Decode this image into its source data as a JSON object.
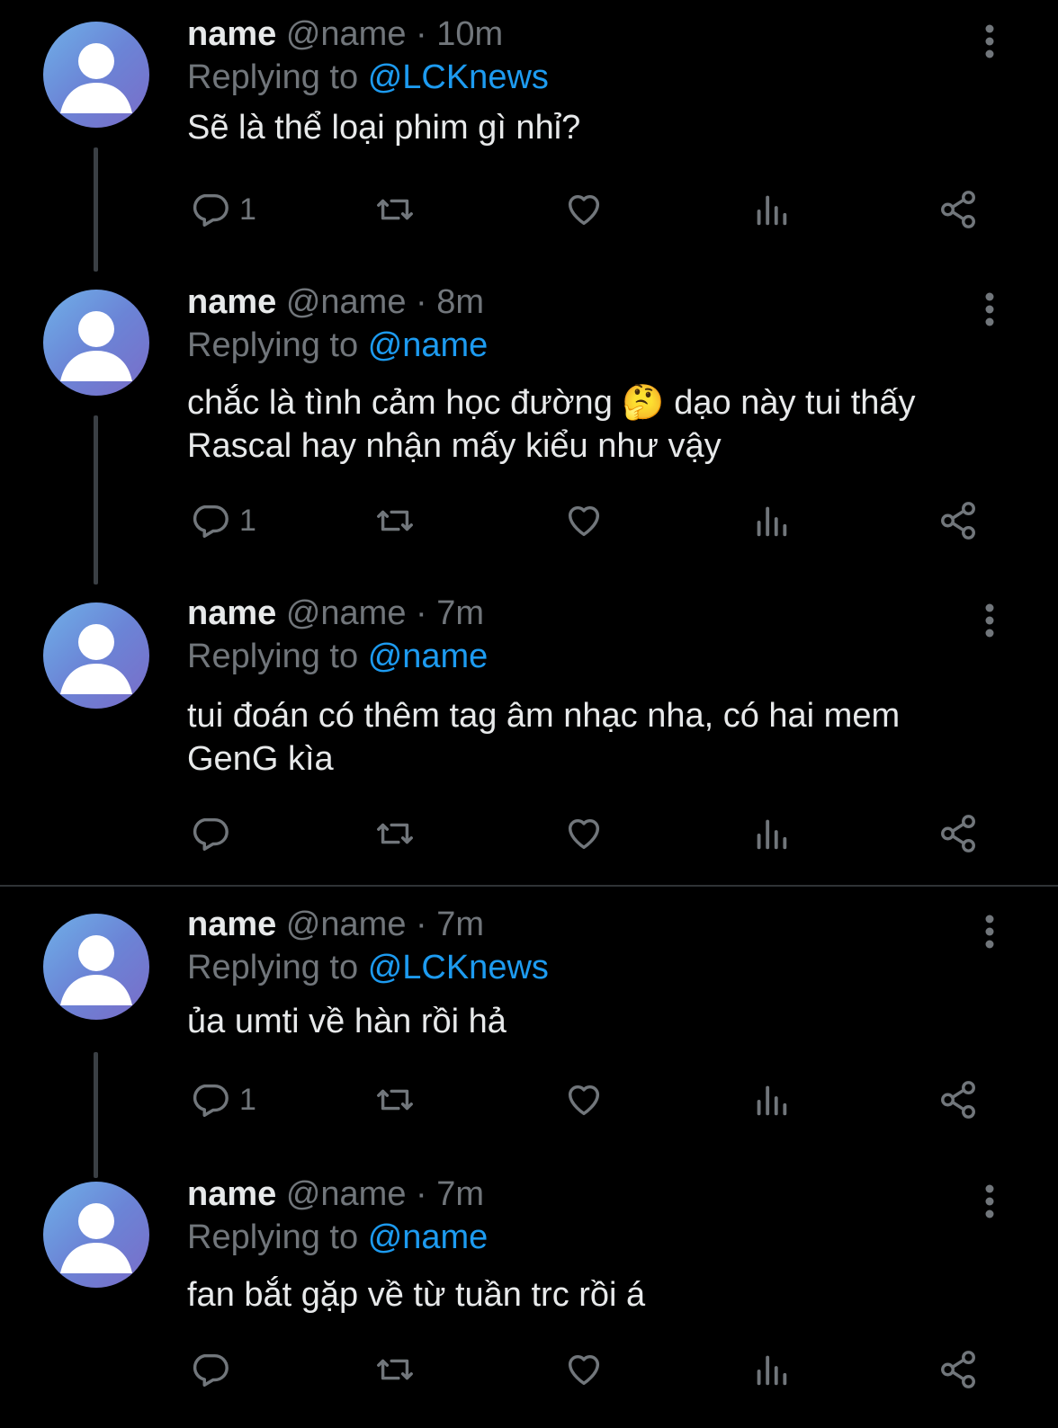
{
  "tweets": [
    {
      "name": "name",
      "handle": "@name",
      "separator": "·",
      "time": "10m",
      "replying_prefix": "Replying to",
      "replying_to": "@LCKnews",
      "text": "Sẽ là thể loại phim gì nhỉ?",
      "reply_count": "1"
    },
    {
      "name": "name",
      "handle": "@name",
      "separator": "·",
      "time": "8m",
      "replying_prefix": "Replying to",
      "replying_to": "@name",
      "text": "chắc là tình cảm học đường 🤔 dạo này tui thấy Rascal hay nhận mấy kiểu như vậy",
      "reply_count": "1"
    },
    {
      "name": "name",
      "handle": "@name",
      "separator": "·",
      "time": "7m",
      "replying_prefix": "Replying to",
      "replying_to": "@name",
      "text": "tui đoán có thêm tag âm nhạc nha, có hai mem GenG kìa",
      "reply_count": ""
    },
    {
      "name": "name",
      "handle": "@name",
      "separator": "·",
      "time": "7m",
      "replying_prefix": "Replying to",
      "replying_to": "@LCKnews",
      "text": "ủa umti về hàn rồi hả",
      "reply_count": "1"
    },
    {
      "name": "name",
      "handle": "@name",
      "separator": "·",
      "time": "7m",
      "replying_prefix": "Replying to",
      "replying_to": "@name",
      "text": "fan bắt gặp về từ tuần trc rồi á",
      "reply_count": ""
    }
  ],
  "icons": {
    "reply": "reply-icon",
    "retweet": "retweet-icon",
    "like": "heart-icon",
    "views": "analytics-icon",
    "share": "share-icon",
    "more": "more-vertical-icon",
    "avatar": "default-avatar-icon"
  },
  "colors": {
    "background": "#000000",
    "text": "#e7e9ea",
    "muted": "#71767b",
    "link": "#1d9bf0",
    "avatar": "#6b84d6"
  }
}
